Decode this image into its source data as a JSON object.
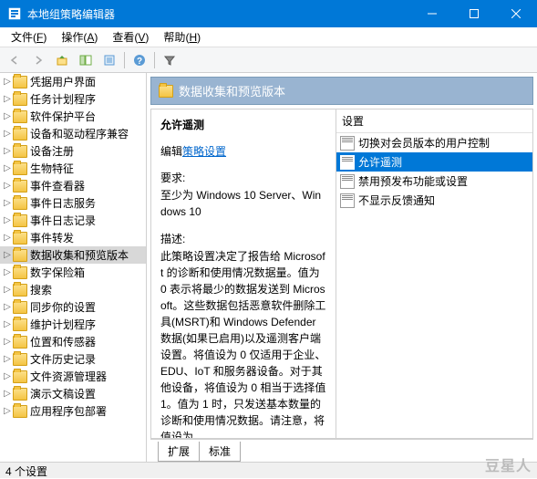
{
  "window": {
    "title": "本地组策略编辑器"
  },
  "menu": {
    "file": {
      "label": "文件",
      "key": "F"
    },
    "action": {
      "label": "操作",
      "key": "A"
    },
    "view": {
      "label": "查看",
      "key": "V"
    },
    "help": {
      "label": "帮助",
      "key": "H"
    }
  },
  "tree": {
    "items": [
      {
        "label": "凭据用户界面"
      },
      {
        "label": "任务计划程序"
      },
      {
        "label": "软件保护平台"
      },
      {
        "label": "设备和驱动程序兼容"
      },
      {
        "label": "设备注册"
      },
      {
        "label": "生物特征"
      },
      {
        "label": "事件查看器"
      },
      {
        "label": "事件日志服务"
      },
      {
        "label": "事件日志记录"
      },
      {
        "label": "事件转发"
      },
      {
        "label": "数据收集和预览版本",
        "selected": true
      },
      {
        "label": "数字保险箱"
      },
      {
        "label": "搜索"
      },
      {
        "label": "同步你的设置"
      },
      {
        "label": "维护计划程序"
      },
      {
        "label": "位置和传感器"
      },
      {
        "label": "文件历史记录"
      },
      {
        "label": "文件资源管理器"
      },
      {
        "label": "演示文稿设置"
      },
      {
        "label": "应用程序包部署"
      }
    ]
  },
  "header": {
    "title": "数据收集和预览版本"
  },
  "detail": {
    "title": "允许遥测",
    "edit_prefix": "编辑",
    "edit_link": "策略设置",
    "req_label": "要求:",
    "req_text": "至少为 Windows 10 Server、Windows 10",
    "desc_label": "描述:",
    "desc_text": "此策略设置决定了报告给 Microsoft 的诊断和使用情况数据量。值为 0 表示将最少的数据发送到 Microsoft。这些数据包括恶意软件删除工具(MSRT)和 Windows Defender 数据(如果已启用)以及遥测客户端设置。将值设为 0 仅适用于企业、EDU、IoT 和服务器设备。对于其他设备，将值设为 0 相当于选择值 1。值为 1 时，只发送基本数量的诊断和使用情况数据。请注意，将值设为"
  },
  "list": {
    "col": "设置",
    "items": [
      {
        "label": "切换对会员版本的用户控制"
      },
      {
        "label": "允许遥测",
        "selected": true
      },
      {
        "label": "禁用预发布功能或设置"
      },
      {
        "label": "不显示反馈通知"
      }
    ]
  },
  "tabs": {
    "extended": "扩展",
    "standard": "标准"
  },
  "status": "4 个设置",
  "watermark": "豆星人"
}
